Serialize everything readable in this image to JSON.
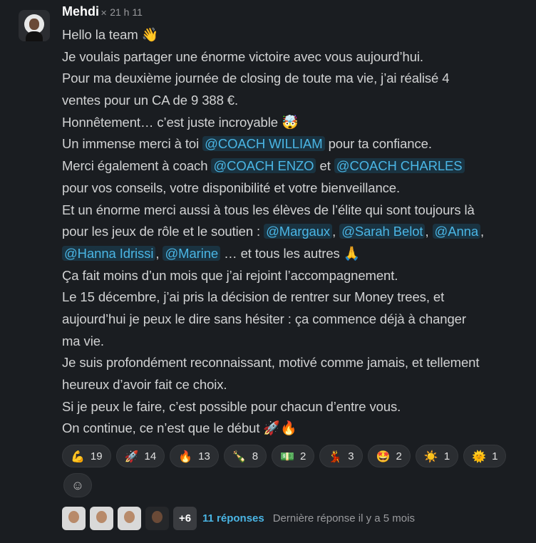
{
  "message": {
    "author": "Mehdi",
    "time": "21 h 11",
    "lines": [
      [
        "Hello la team ",
        {
          "emoji": "👋"
        }
      ],
      [
        "Je voulais partager une énorme victoire avec vous aujourd’hui."
      ],
      [
        "Pour ma deuxième journée de closing de toute ma vie, j’ai réalisé 4"
      ],
      [
        "ventes pour un CA de 9 388 €."
      ],
      [
        "Honnêtement… c’est juste incroyable ",
        {
          "emoji": "🤯"
        }
      ],
      [
        "Un immense merci à toi ",
        {
          "mention": "@COACH WILLIAM"
        },
        " pour ta confiance."
      ],
      [
        "Merci également à coach ",
        {
          "mention": "@COACH ENZO"
        },
        " et ",
        {
          "mention": "@COACH CHARLES"
        }
      ],
      [
        "pour vos conseils, votre disponibilité et votre bienveillance."
      ],
      [
        "Et un énorme merci aussi à tous les élèves de l’élite qui sont toujours là"
      ],
      [
        "pour les jeux de rôle et le soutien : ",
        {
          "mention": "@Margaux"
        },
        ", ",
        {
          "mention": "@Sarah Belot"
        },
        ", ",
        {
          "mention": "@Anna"
        },
        ","
      ],
      [
        {
          "mention": "@Hanna Idrissi"
        },
        ", ",
        {
          "mention": "@Marine"
        },
        " … et tous les autres ",
        {
          "emoji": "🙏"
        }
      ],
      [
        "Ça fait moins d’un mois que j’ai rejoint l’accompagnement."
      ],
      [
        "Le 15 décembre, j’ai pris la décision de rentrer sur Money trees, et"
      ],
      [
        "aujourd’hui je peux le dire sans hésiter : ça commence déjà à changer"
      ],
      [
        "ma vie."
      ],
      [
        "Je suis profondément reconnaissant, motivé comme jamais, et tellement"
      ],
      [
        "heureux d’avoir fait ce choix."
      ],
      [
        "Si je peux le faire, c’est possible pour chacun d’entre vous."
      ],
      [
        "On continue, ce n’est que le début ",
        {
          "emoji": "🚀🔥"
        }
      ]
    ]
  },
  "reactions": [
    {
      "icon": "flexed-biceps",
      "emoji": "💪",
      "count": "19"
    },
    {
      "icon": "rocket",
      "emoji": "🚀",
      "count": "14"
    },
    {
      "icon": "fire",
      "emoji": "🔥",
      "count": "13"
    },
    {
      "icon": "champagne",
      "emoji": "🍾",
      "count": "8"
    },
    {
      "icon": "dollar-banknote",
      "emoji": "💵",
      "count": "2"
    },
    {
      "icon": "dancer",
      "emoji": "💃",
      "count": "3"
    },
    {
      "icon": "star-struck",
      "emoji": "🤩",
      "count": "2"
    },
    {
      "icon": "sun",
      "emoji": "☀️",
      "count": "1"
    },
    {
      "icon": "sun-with-face",
      "emoji": "🌞",
      "count": "1"
    }
  ],
  "add_reaction": {
    "icon": "smiley-plus-icon",
    "glyph": "☺"
  },
  "thread": {
    "more_count": "+6",
    "replies": "11 réponses",
    "last_reply": "Dernière réponse il y a 5 mois"
  },
  "colors": {
    "background": "#1a1d21",
    "mention": "#4ab5e4",
    "link": "#4ab5e4"
  }
}
